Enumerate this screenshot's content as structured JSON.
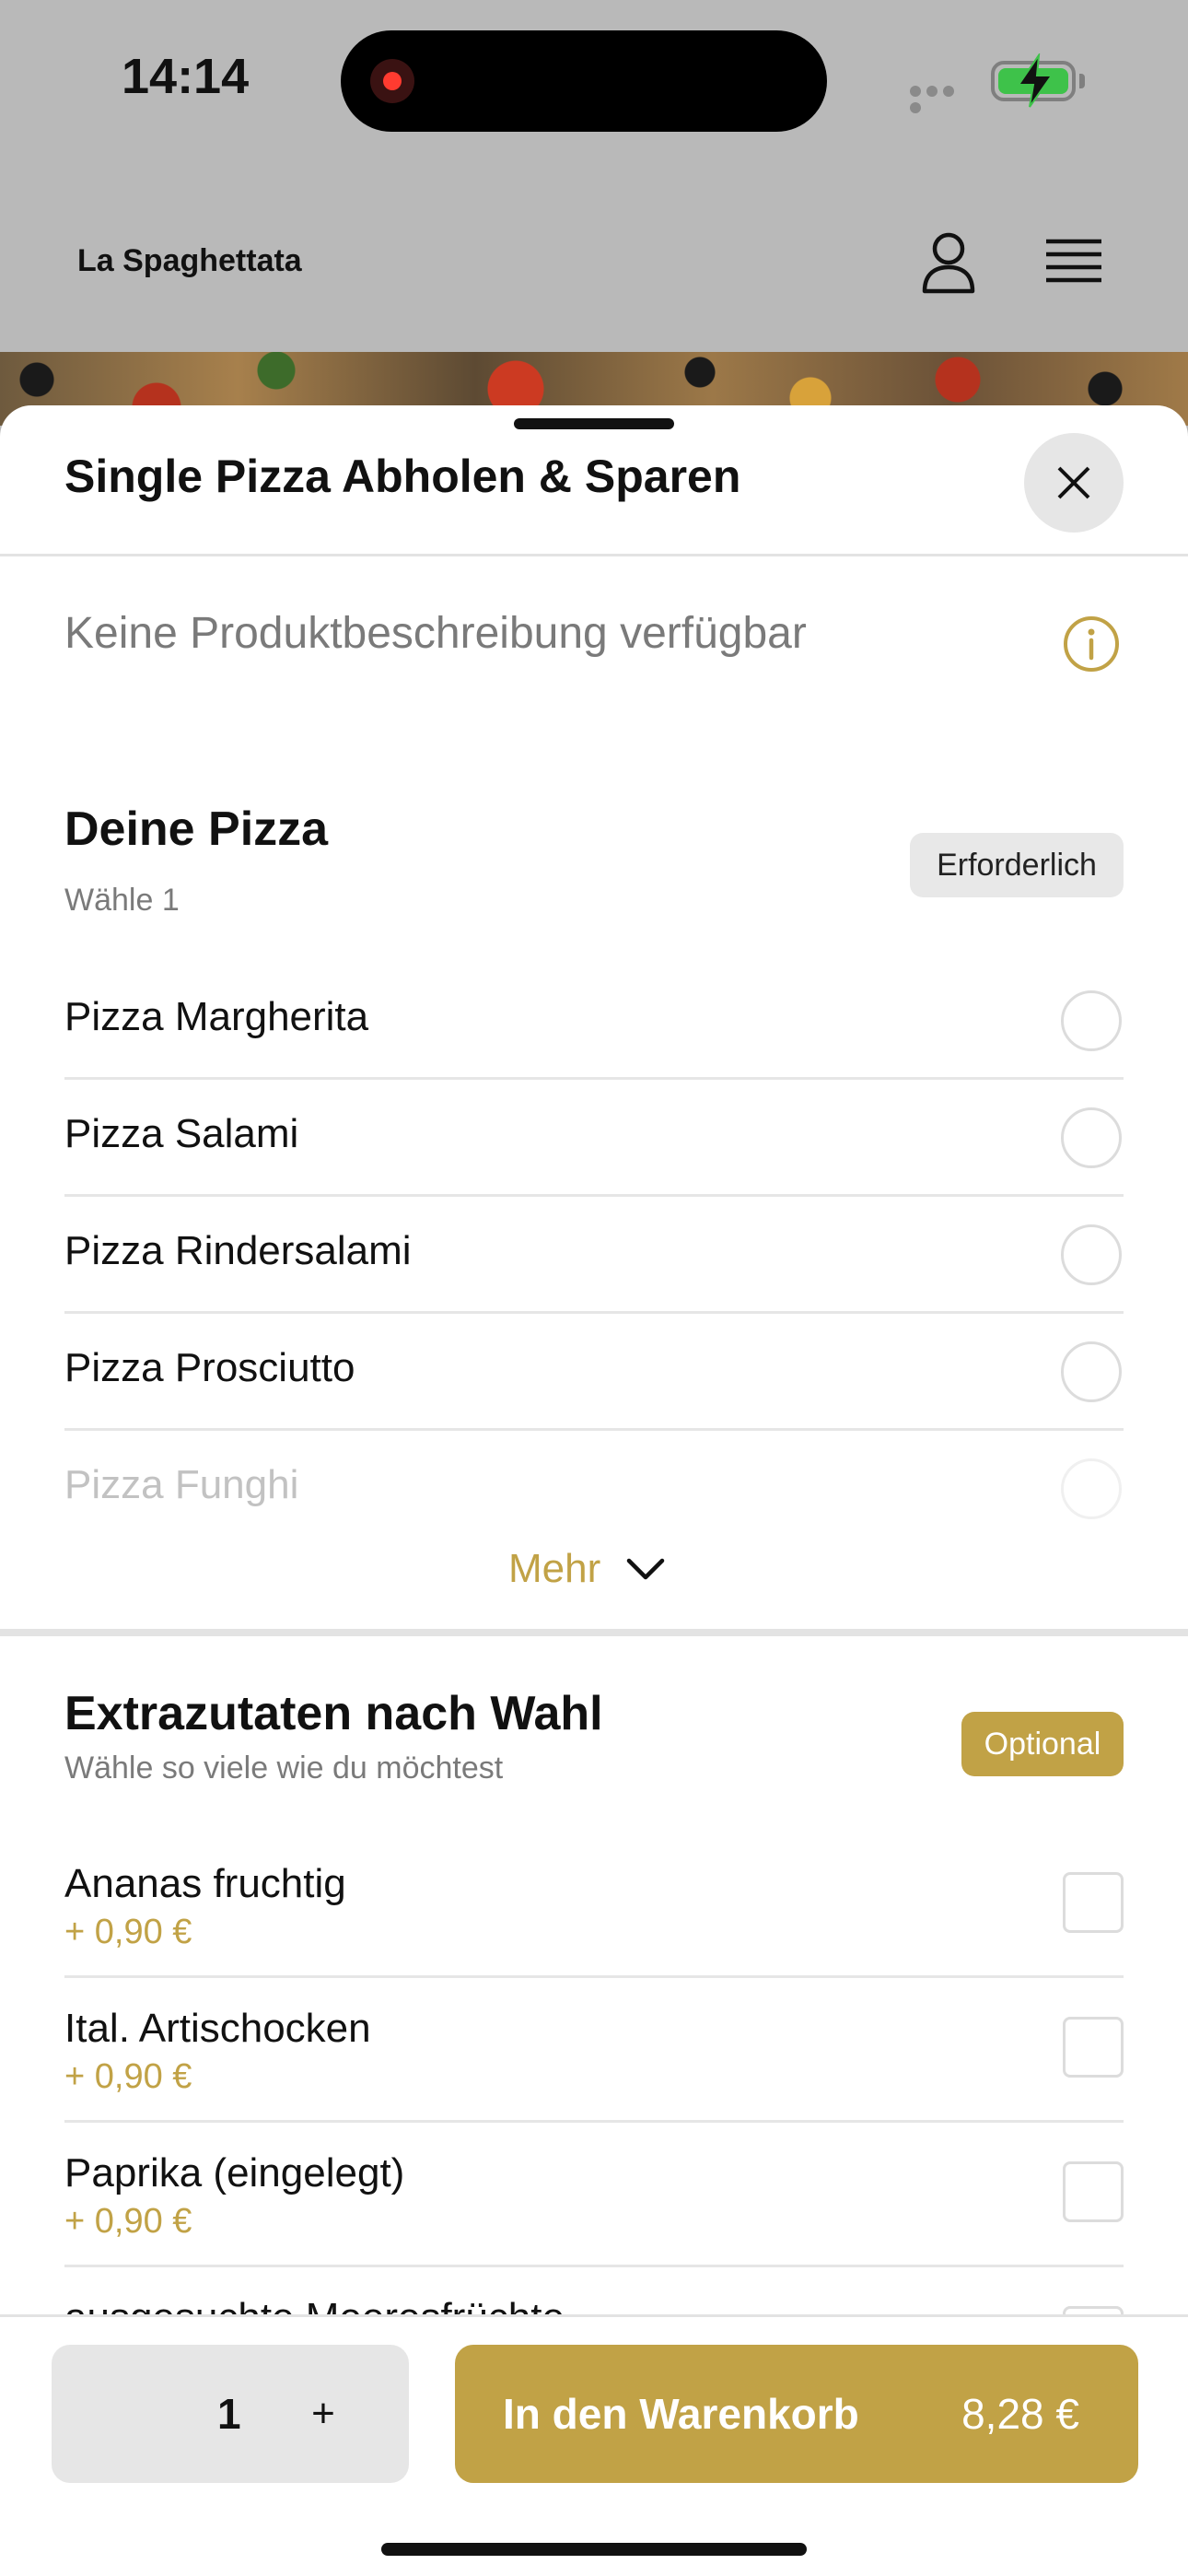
{
  "status_bar": {
    "time": "14:14"
  },
  "app_header": {
    "restaurant_name": "La Spaghettata"
  },
  "sheet": {
    "title": "Single Pizza Abholen & Sparen",
    "description": "Keine Produktbeschreibung verfügbar"
  },
  "pizza_section": {
    "title": "Deine Pizza",
    "subtitle": "Wähle 1",
    "badge": "Erforderlich",
    "options": [
      {
        "label": "Pizza Margherita"
      },
      {
        "label": "Pizza Salami"
      },
      {
        "label": "Pizza Rindersalami"
      },
      {
        "label": "Pizza Prosciutto"
      },
      {
        "label": "Pizza Funghi"
      }
    ],
    "more_label": "Mehr"
  },
  "extras_section": {
    "title": "Extrazutaten nach Wahl",
    "subtitle": "Wähle so viele wie du möchtest",
    "badge": "Optional",
    "items": [
      {
        "label": "Ananas fruchtig",
        "price": "+ 0,90 €"
      },
      {
        "label": "Ital. Artischocken",
        "price": "+ 0,90 €"
      },
      {
        "label": "Paprika (eingelegt)",
        "price": "+ 0,90 €"
      },
      {
        "label": "ausgesuchte Meeresfrüchte"
      }
    ]
  },
  "action_bar": {
    "quantity": "1",
    "plus_label": "+",
    "cart_label": "In den Warenkorb",
    "cart_total": "8,28 €"
  },
  "colors": {
    "accent": "#c1a246",
    "overlay": "#b9b9b9",
    "divider": "#e3e3e3"
  },
  "icons": {
    "account": "person-icon",
    "menu": "hamburger-menu-icon",
    "close": "close-icon",
    "info": "info-icon",
    "more": "chevron-down-icon"
  }
}
